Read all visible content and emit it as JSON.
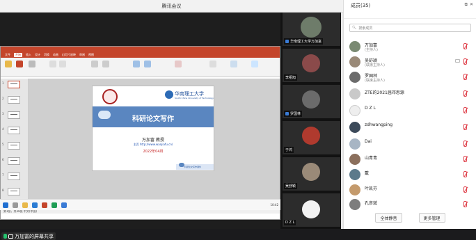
{
  "window": {
    "title": "腾讯会议"
  },
  "share": {
    "label": "万加富的屏幕共享",
    "ppt": {
      "file_title": "",
      "menu": [
        "文件",
        "开始",
        "插入",
        "设计",
        "切换",
        "动画",
        "幻灯片放映",
        "审阅",
        "视图"
      ],
      "slide_count": [
        "1",
        "2",
        "3",
        "4",
        "5",
        "6",
        "7",
        "8"
      ],
      "status": "第1张，共38张  中文(中国)",
      "slide": {
        "title": "科研论文写作",
        "university": "华南理工大学",
        "university_en": "South China University of Technology",
        "author": "万加富  教授",
        "homepage": "主页 http://www.wanjiafu.cn/",
        "date": "2022年04月",
        "footer": "科研论文写作课件"
      },
      "clock": "10:42"
    }
  },
  "videos": [
    {
      "name": "华南理工大学万加富"
    },
    {
      "name": "李祖旭"
    },
    {
      "name": "罗国林"
    },
    {
      "name": "于鸿"
    },
    {
      "name": "吴舒颖"
    },
    {
      "name": ""
    },
    {
      "name": "D Z L"
    }
  ],
  "panel": {
    "title": "成员(35)",
    "search_placeholder": "搜索成员",
    "members": [
      {
        "name": "万加富",
        "sub": "(主持人)"
      },
      {
        "name": "吴舒颖",
        "sub": "(联席主持人)"
      },
      {
        "name": "罗国林",
        "sub": "(联席主持人)"
      },
      {
        "name": "ZTE的2021届邓思源",
        "sub": ""
      },
      {
        "name": "D Z L",
        "sub": ""
      },
      {
        "name": "zdhwangping",
        "sub": ""
      },
      {
        "name": "Dai",
        "sub": ""
      },
      {
        "name": "山青青",
        "sub": ""
      },
      {
        "name": "戴",
        "sub": ""
      },
      {
        "name": "叶凯芬",
        "sub": ""
      },
      {
        "name": "孔彦斌",
        "sub": ""
      }
    ],
    "buttons": {
      "mute_all": "全体静音",
      "more": "更多管理"
    }
  },
  "colors": {
    "ppt_red": "#c4452b",
    "slide_blue": "#5a86c0",
    "mute_red": "#e0454f",
    "mic_green": "#25c26e"
  }
}
